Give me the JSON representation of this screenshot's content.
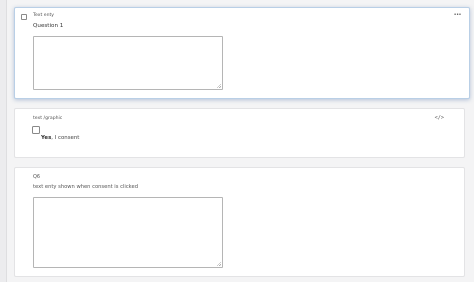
{
  "questions": [
    {
      "type_label": "Text enty",
      "question_text": "Question 1"
    }
  ],
  "graphic_block": {
    "type_label": "text /graphic",
    "consent_bold": "Yes",
    "consent_rest": ", I consent",
    "code_icon": "</>"
  },
  "question_6": {
    "number_label": "Q6",
    "question_text": "text enty shown when consent is clicked"
  },
  "more_icon": "•••"
}
